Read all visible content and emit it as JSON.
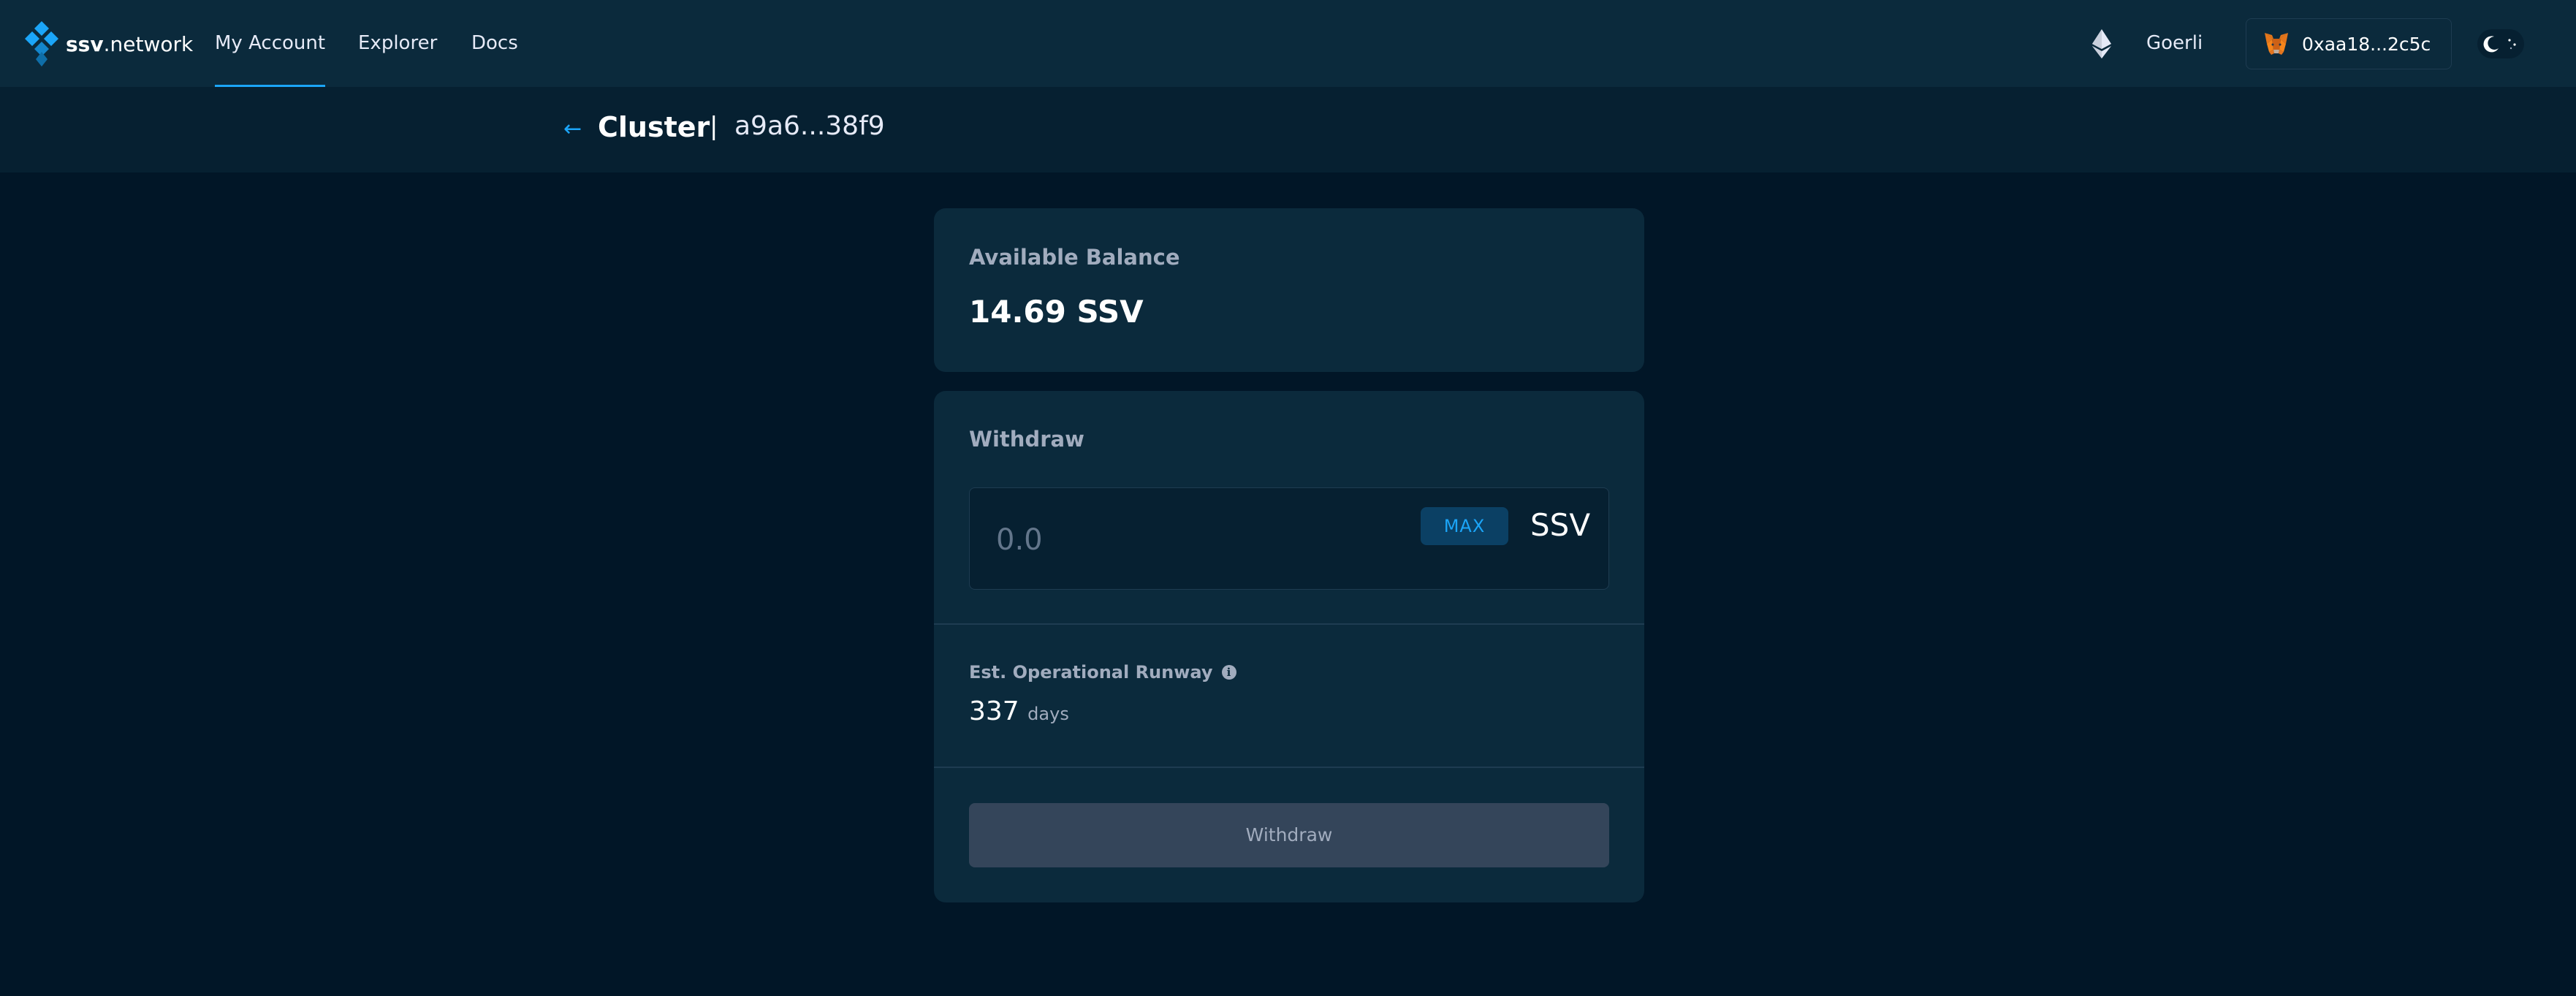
{
  "nav": {
    "logo_bold": "ssv",
    "logo_rest": ".network",
    "links": [
      {
        "label": "My Account",
        "active": true
      },
      {
        "label": "Explorer",
        "active": false
      },
      {
        "label": "Docs",
        "active": false
      }
    ],
    "network": "Goerli",
    "wallet_address": "0xaa18...2c5c"
  },
  "header": {
    "back_icon": "←",
    "title": "Cluster",
    "separator": "|",
    "cluster_id": "a9a6...38f9"
  },
  "balance": {
    "label": "Available Balance",
    "value": "14.69 SSV"
  },
  "withdraw": {
    "title": "Withdraw",
    "amount_placeholder": "0.0",
    "max_label": "MAX",
    "unit": "SSV",
    "runway_label": "Est. Operational Runway",
    "runway_value": "337",
    "runway_unit": "days",
    "button_label": "Withdraw",
    "button_disabled": true
  },
  "colors": {
    "background": "#011627",
    "nav_bg": "#0b2a3c",
    "card_bg": "#0b2a3c",
    "accent": "#1ba5f8",
    "muted_text": "#a1acbe",
    "disabled_button": "#34455a"
  },
  "icons": {
    "logo": "ssv-diamond-logo-icon",
    "network": "ethereum-icon",
    "wallet": "metamask-fox-icon",
    "theme": "moon-icon",
    "info": "info-icon"
  }
}
